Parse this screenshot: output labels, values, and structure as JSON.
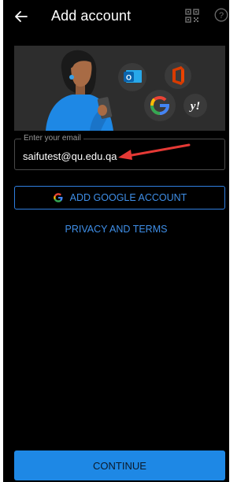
{
  "header": {
    "title": "Add account",
    "back_icon": "arrow-left-icon",
    "qr_icon": "qr-code-icon",
    "help_icon": "help-circle-icon"
  },
  "hero": {
    "illustration": "woman-with-phone",
    "logos": [
      "outlook-logo",
      "office-logo",
      "google-logo",
      "yahoo-logo"
    ],
    "yahoo_text": "y!"
  },
  "email_field": {
    "label": "Enter your email",
    "value": "saifutest@qu.edu.qa"
  },
  "buttons": {
    "google_label": "ADD GOOGLE ACCOUNT",
    "privacy_label": "PRIVACY AND TERMS",
    "continue_label": "CONTINUE"
  },
  "colors": {
    "background": "#000000",
    "accent": "#1e88e5",
    "link": "#3f8fe8",
    "annotation_arrow": "#e53935"
  }
}
